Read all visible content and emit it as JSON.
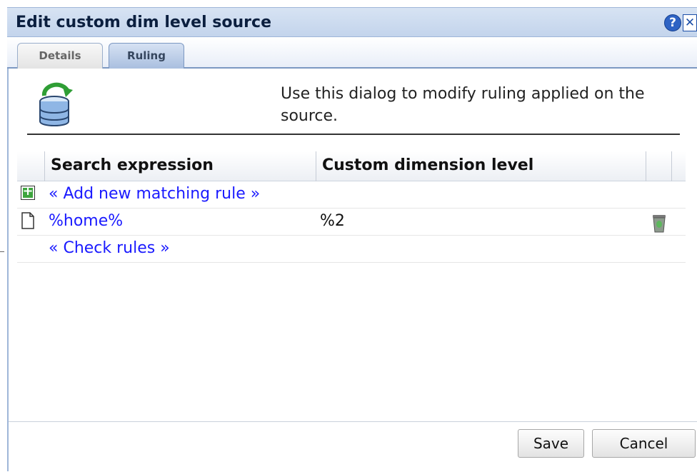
{
  "dialog": {
    "title": "Edit custom dim level source",
    "help_icon": "help-icon",
    "close_icon": "close-icon"
  },
  "tabs": [
    {
      "label": "Details",
      "active": false
    },
    {
      "label": "Ruling",
      "active": true
    }
  ],
  "intro": {
    "icon": "database-refresh-icon",
    "text": "Use this dialog to modify ruling applied on the source."
  },
  "table": {
    "columns": [
      "Search expression",
      "Custom dimension level"
    ],
    "add_rule_label": "« Add new matching rule »",
    "rows": [
      {
        "search_expression": "%home%",
        "custom_dimension_level": "%2"
      }
    ],
    "check_rules_label": "« Check rules »"
  },
  "buttons": {
    "save": "Save",
    "cancel": "Cancel"
  },
  "colors": {
    "title_bar": "#c9d9ef",
    "link": "#1a1aff",
    "add_icon": "#3ea53e"
  }
}
